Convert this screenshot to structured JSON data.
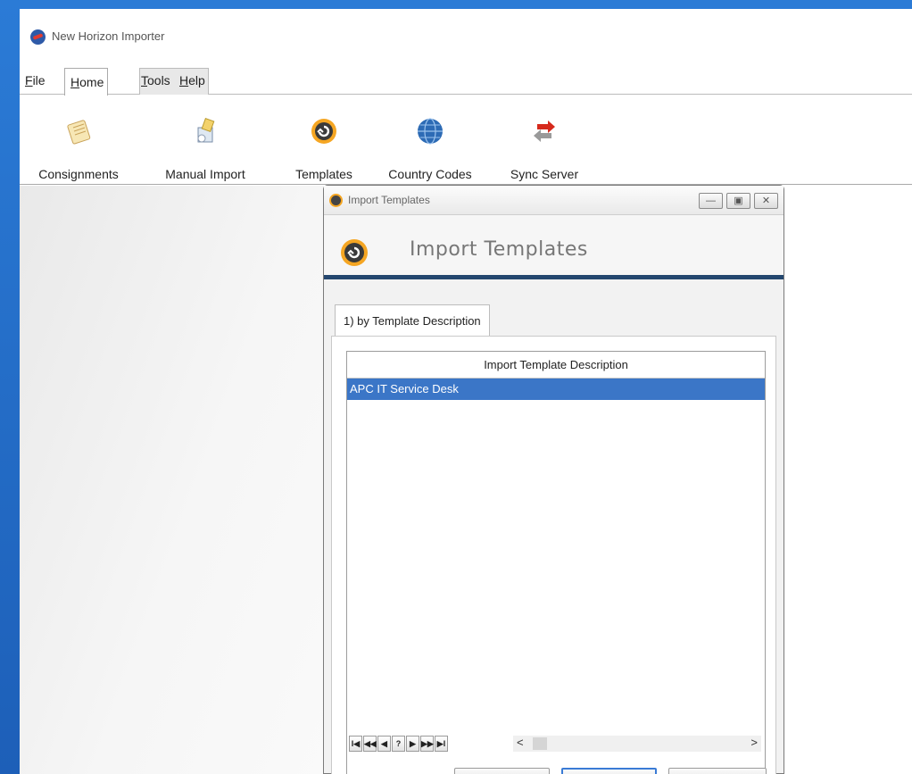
{
  "app": {
    "title": "New Horizon Importer"
  },
  "menu": [
    {
      "label": "File"
    },
    {
      "label": "Home"
    },
    {
      "label": "Tools"
    },
    {
      "label": "Help"
    }
  ],
  "ribbon": [
    {
      "label": "Consignments",
      "icon": "notepad-icon"
    },
    {
      "label": "Manual Import",
      "icon": "import-box-icon"
    },
    {
      "label": "Templates",
      "icon": "template-icon"
    },
    {
      "label": "Country Codes",
      "icon": "globe-icon"
    },
    {
      "label": "Sync Server",
      "icon": "sync-arrows-icon"
    }
  ],
  "dialog": {
    "window_title": "Import Templates",
    "header_title": "Import Templates",
    "tab_label": "1) by Template Description",
    "grid": {
      "column_header": "Import Template Description",
      "rows": [
        "APC IT Service Desk"
      ],
      "selected_index": 0
    },
    "navigator": [
      "I◀",
      "◀◀",
      "◀",
      "?",
      "▶",
      "▶▶",
      "▶I"
    ],
    "scroll": {
      "left": "<",
      "right": ">"
    }
  },
  "colors": {
    "accent": "#24476f",
    "selection": "#3b76c7",
    "template_ring": "#f5a623"
  }
}
